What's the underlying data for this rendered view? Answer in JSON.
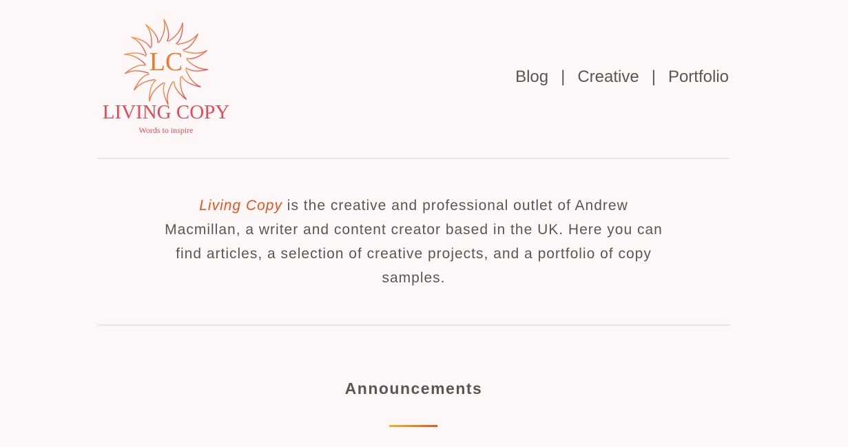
{
  "logo": {
    "monogram": "LC",
    "name": "LIVING COPY",
    "tagline": "Words to inspire"
  },
  "nav": {
    "items": [
      "Blog",
      "Creative",
      "Portfolio"
    ],
    "separator": "|"
  },
  "intro": {
    "brand": "Living Copy",
    "text": " is the creative and professional outlet of Andrew Macmillan, a writer and content creator based in the UK. Here you can find articles, a selection of creative projects, and a portfolio of copy samples."
  },
  "announcements": {
    "title": "Announcements"
  },
  "colors": {
    "background": "#fdf8f7",
    "text": "#5a5653",
    "accent_orange": "#e8541b",
    "accent_yellow": "#f5b324",
    "logo_red": "#e84a55"
  }
}
